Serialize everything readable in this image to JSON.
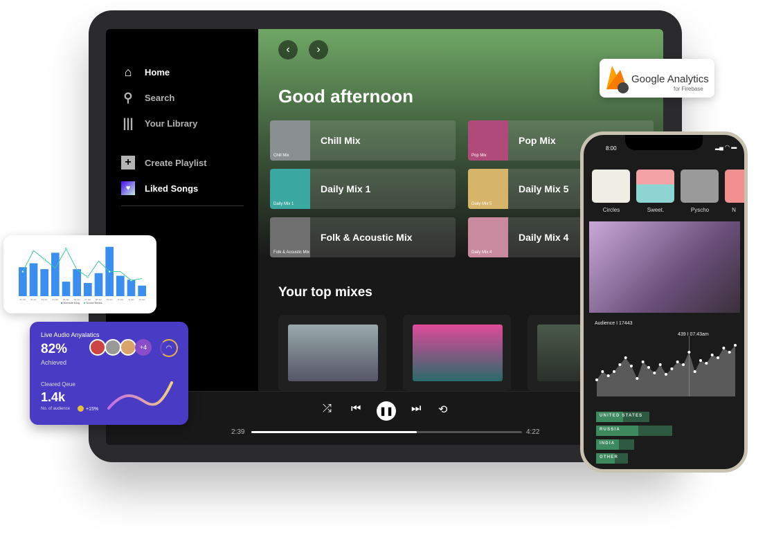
{
  "sidebar": {
    "items": [
      {
        "label": "Home",
        "icon": "home-icon"
      },
      {
        "label": "Search",
        "icon": "search-icon"
      },
      {
        "label": "Your Library",
        "icon": "library-icon"
      },
      {
        "label": "Create Playlist",
        "icon": "plus-icon"
      },
      {
        "label": "Liked Songs",
        "icon": "heart-icon"
      }
    ]
  },
  "main": {
    "greeting": "Good afternoon",
    "cards": [
      {
        "title": "Chill Mix",
        "art_label": "Chill Mix",
        "color": "#8a8f92"
      },
      {
        "title": "Pop Mix",
        "art_label": "Pop Mix",
        "color": "#b04a7a"
      },
      {
        "title": "Daily Mix 1",
        "art_label": "Daily Mix 1",
        "color": "#3aa7a0"
      },
      {
        "title": "Daily Mix 5",
        "art_label": "Daily Mix 5",
        "color": "#d6b46a"
      },
      {
        "title": "Folk & Acoustic Mix",
        "art_label": "Folk & Acoustic Mix",
        "color": "#6f6f6f"
      },
      {
        "title": "Daily Mix 4",
        "art_label": "Daily Mix 4",
        "color": "#c98aa0"
      }
    ],
    "section_title": "Your top mixes"
  },
  "player": {
    "elapsed": "2:39",
    "duration": "4:22",
    "progress": 0.61
  },
  "badge": {
    "title": "Google Analytics",
    "subtitle": "for Firebase"
  },
  "phone": {
    "time": "8:00",
    "albums": [
      "Circles",
      "Sweet.",
      "Pyscho",
      "N"
    ],
    "audience_label": "Audience I 17443",
    "peak_label": "439 I 07:43am",
    "audience_series": [
      330,
      360,
      345,
      360,
      385,
      410,
      380,
      335,
      395,
      375,
      355,
      385,
      350,
      370,
      395,
      385,
      430,
      360,
      400,
      390,
      420,
      410,
      445,
      430,
      455
    ],
    "countries": [
      {
        "label": "UNITED STATES",
        "value": 0.35,
        "max": 0.7
      },
      {
        "label": "RUSSIA",
        "value": 0.55,
        "max": 1.0
      },
      {
        "label": "INDIA",
        "value": 0.3,
        "max": 0.5
      },
      {
        "label": "OTHER",
        "value": 0.25,
        "max": 0.42
      }
    ]
  },
  "chart_data": {
    "type": "bar",
    "categories": [
      "01 Jan",
      "02 Jan",
      "03 Jan",
      "04 Jan",
      "05 Jan",
      "06 Jan",
      "07 Jan",
      "08 Jan",
      "09 Jan",
      "10 Jan",
      "11 Jan",
      "12 Jan"
    ],
    "ylim": [
      0,
      800
    ],
    "series": [
      {
        "name": "Website Blog",
        "type": "bar",
        "values": [
          440,
          500,
          410,
          660,
          220,
          410,
          200,
          350,
          750,
          310,
          250,
          160
        ],
        "color": "#3a8ef0"
      },
      {
        "name": "Social Media",
        "type": "line",
        "values": [
          28,
          52,
          42,
          32,
          54,
          30,
          22,
          40,
          28,
          28,
          18,
          20
        ],
        "color": "#3ec9a0",
        "ylim": [
          0,
          60
        ]
      }
    ],
    "legend": "bottom"
  },
  "analytics_card": {
    "title": "Live Audio Anyalatics",
    "percent": "82%",
    "percent_label": "Achieved",
    "more": "+4",
    "queue_label": "Cleared Qeue",
    "queue_value": "1.4k",
    "audience_label": "No. of audience",
    "change": "+15%"
  }
}
